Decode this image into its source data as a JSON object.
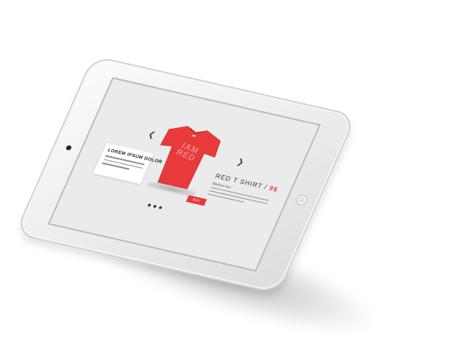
{
  "product_card": {
    "title": "LOREM IPSUM DOLOR"
  },
  "tshirt": {
    "print_text_line1": "IAM",
    "print_text_line2": "RED"
  },
  "product": {
    "title": "RED T SHIRT / ",
    "price": "9$",
    "subtitle": "Medium fun"
  },
  "buy_button": {
    "label": "BUY"
  },
  "navigation": {
    "prev_icon": "chevron-left-icon",
    "next_icon": "chevron-right-icon"
  },
  "pager": {
    "total_dots": 3
  },
  "colors": {
    "accent": "#e8393b",
    "shirt": "#e8393b",
    "screen_bg": "#ebebeb",
    "device_body": "#eeeeee"
  }
}
